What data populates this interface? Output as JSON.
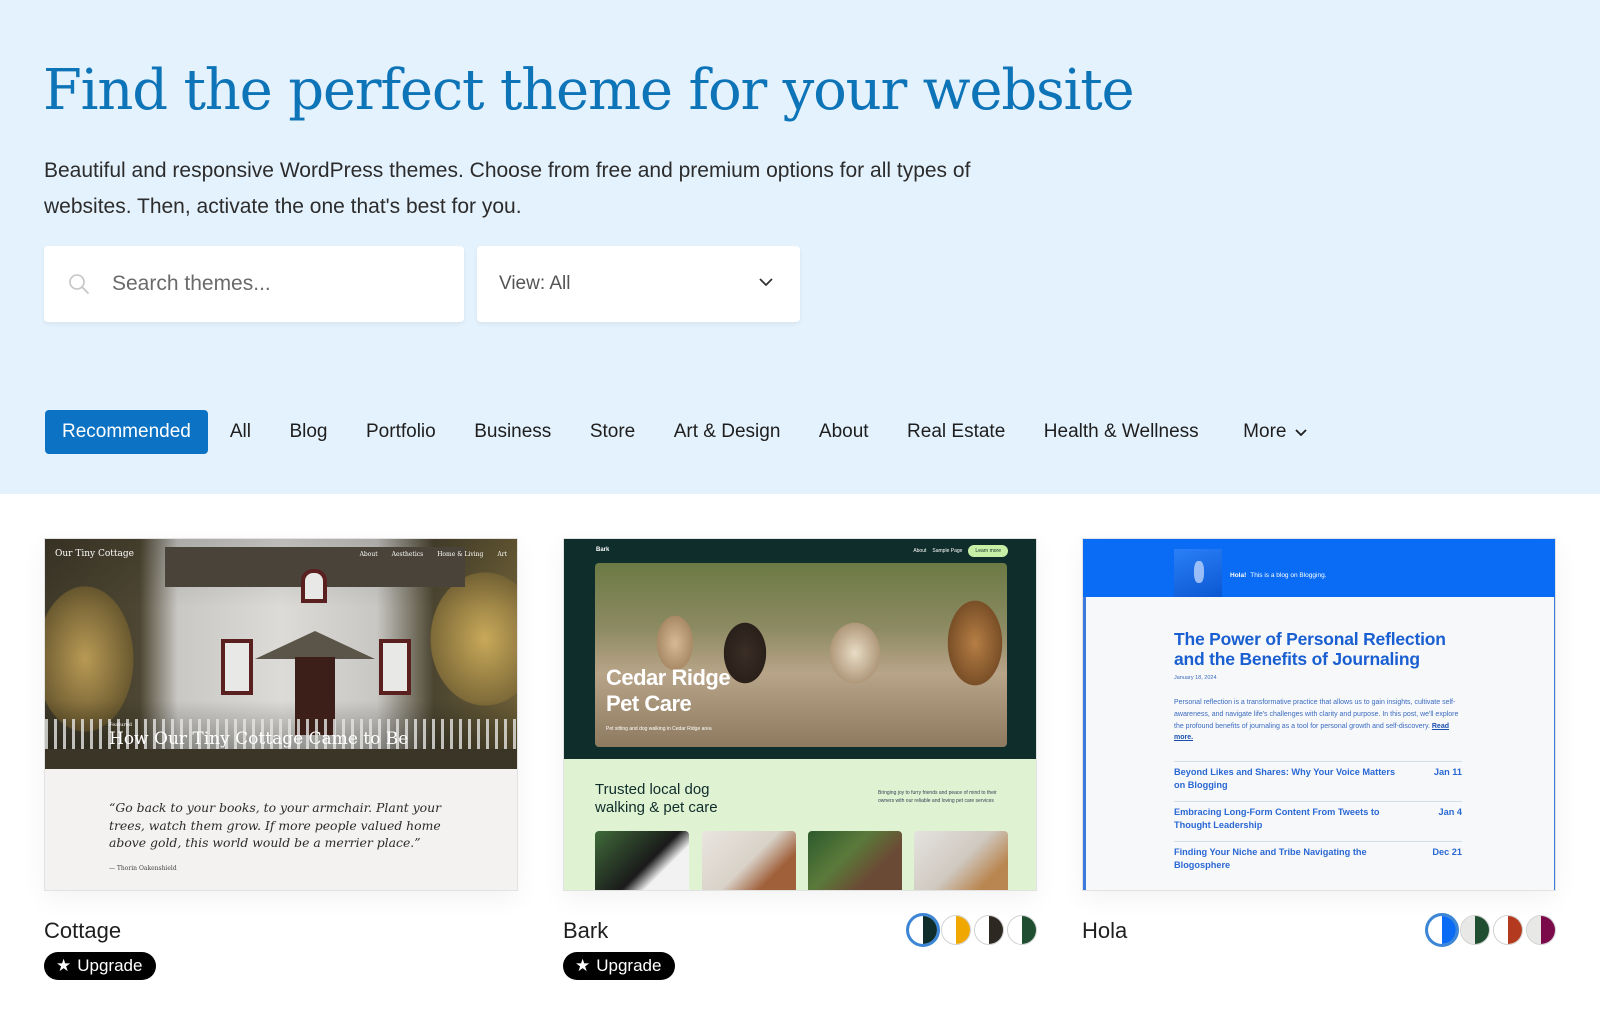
{
  "hero": {
    "title": "Find the perfect theme for your website",
    "subtitle": "Beautiful and responsive WordPress themes. Choose from free and premium options for all types of websites. Then, activate the one that's best for you.",
    "search": {
      "placeholder": "Search themes...",
      "value": "",
      "icon": "search-icon"
    },
    "view_select": {
      "label": "View: All",
      "icon": "chevron-down-icon"
    },
    "colors": {
      "background": "#e4f2fd",
      "title": "#0e74b8",
      "active_tab": "#0b72c4"
    }
  },
  "tabs": [
    {
      "label": "Recommended",
      "active": true
    },
    {
      "label": "All"
    },
    {
      "label": "Blog"
    },
    {
      "label": "Portfolio"
    },
    {
      "label": "Business"
    },
    {
      "label": "Store"
    },
    {
      "label": "Art & Design"
    },
    {
      "label": "About"
    },
    {
      "label": "Real Estate"
    },
    {
      "label": "Health & Wellness"
    },
    {
      "label": "More"
    }
  ],
  "themes": [
    {
      "name": "Cottage",
      "badge": "Upgrade",
      "badge_icon": "star-icon",
      "preview": {
        "site_title": "Our Tiny Cottage",
        "nav": [
          "About",
          "Aesthetics",
          "Home & Living",
          "Art"
        ],
        "kicker": "Featured",
        "headline": "How Our Tiny Cottage Came to Be",
        "quote": "“Go back to your books, to your armchair. Plant your trees, watch them grow. If more people valued home above gold, this world would be a merrier place.”",
        "attribution": "— Thorin Oakenshield"
      }
    },
    {
      "name": "Bark",
      "badge": "Upgrade",
      "badge_icon": "star-icon",
      "style_variations": [
        {
          "left": "#ffffff",
          "right": "#0f2d2b",
          "selected": true
        },
        {
          "left": "#ffffff",
          "right": "#f0a800"
        },
        {
          "left": "#ffffff",
          "right": "#2e2823"
        },
        {
          "left": "#ffffff",
          "right": "#1f4f30"
        }
      ],
      "preview": {
        "logo": "Bark",
        "nav": [
          "About",
          "Sample Page"
        ],
        "cta": "Learn more",
        "hero_title": "Cedar Ridge Pet Care",
        "hero_tagline": "Pet sitting and dog walking in Cedar Ridge area",
        "section_title": "Trusted local dog walking & pet care",
        "section_text": "Bringing joy to furry friends and peace of mind to their owners with our reliable and loving pet care services"
      }
    },
    {
      "name": "Hola",
      "style_variations": [
        {
          "left": "#ffffff",
          "right": "#0a6cf5",
          "selected": true
        },
        {
          "left": "#e8e8e6",
          "right": "#1f4f30"
        },
        {
          "left": "#ffffff",
          "right": "#b33a1e"
        },
        {
          "left": "#e8e8e6",
          "right": "#7a0a4a"
        }
      ],
      "preview": {
        "site_name": "Hola!",
        "tagline": "This is a blog on Blogging.",
        "post_title": "The Power of Personal Reflection and the Benefits of Journaling",
        "post_date": "January 18, 2024",
        "excerpt": "Personal reflection is a transformative practice that allows us to gain insights, cultivate self-awareness, and navigate life's challenges with clarity and purpose. In this post, we'll explore the profound benefits of journaling as a tool for personal growth and self-discovery.",
        "read_more": "Read more.",
        "posts": [
          {
            "title": "Beyond Likes and Shares: Why Your Voice Matters on Blogging",
            "date": "Jan 11"
          },
          {
            "title": "Embracing Long-Form Content From Tweets to Thought Leadership",
            "date": "Jan 4"
          },
          {
            "title": "Finding Your Niche and Tribe Navigating the Blogosphere",
            "date": "Dec 21"
          }
        ]
      }
    }
  ]
}
